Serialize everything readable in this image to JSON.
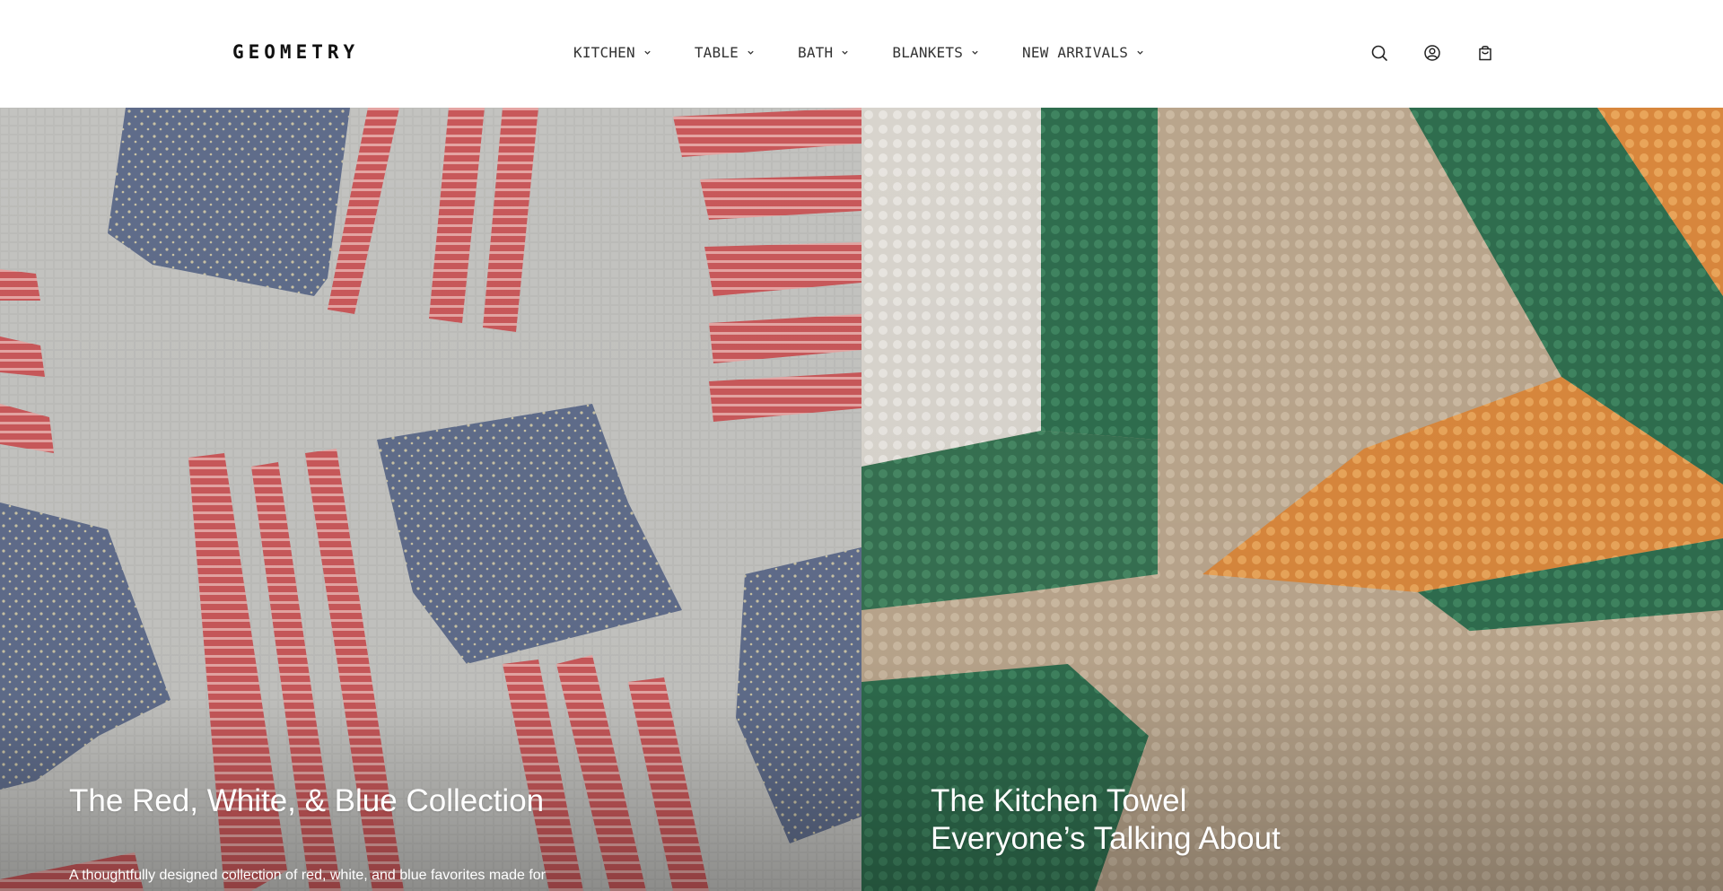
{
  "brand": {
    "logo_text": "GEOMETRY"
  },
  "nav": {
    "items": [
      {
        "label": "KITCHEN"
      },
      {
        "label": "TABLE"
      },
      {
        "label": "BATH"
      },
      {
        "label": "BLANKETS"
      },
      {
        "label": "NEW ARRIVALS"
      }
    ]
  },
  "header_icons": [
    "search-icon",
    "account-icon",
    "cart-icon"
  ],
  "hero": {
    "left": {
      "title": "The Red, White, & Blue Collection",
      "description": "A thoughtfully designed collection of red, white, and blue favorites made for"
    },
    "right": {
      "title_line1": "The Kitchen Towel",
      "title_line2": "Everyone’s Talking About"
    }
  },
  "colors": {
    "header_bg": "#ffffff",
    "nav_text": "#333333",
    "hero_text": "#ffffff"
  }
}
